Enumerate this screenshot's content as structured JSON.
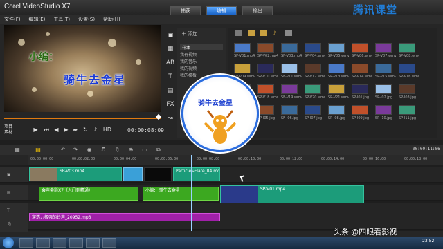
{
  "app": {
    "title": "Corel VideoStudio X7"
  },
  "workspace_tabs": [
    {
      "label": "捕获"
    },
    {
      "label": "编辑"
    },
    {
      "label": "输出"
    }
  ],
  "brand": "腾讯课堂",
  "menu": [
    "文件(F)",
    "编辑(E)",
    "工具(T)",
    "设置(S)",
    "帮助(H)"
  ],
  "preview": {
    "title_line1": "小编：",
    "title_line2": "骑牛去金星",
    "project_label": "项目",
    "clip_label": "素材",
    "hd_label": "HD",
    "timecode": "00:00:08:09",
    "progress": 1.0
  },
  "library": {
    "add_label": "添加",
    "nav_items": [
      "样本",
      "我有视频",
      "我的音乐",
      "我的视频",
      "我的模板"
    ],
    "selected_nav": "样本",
    "thumbs": [
      [
        "SP-V01.mp4",
        "SP-V02.mp4",
        "SP-V03.mp4",
        "SP-V04.wmv",
        "SP-V05.wmv",
        "SP-V06.wmv",
        "SP-V07.wmv",
        "SP-V08.wmv"
      ],
      [
        "SP-V09.wmv",
        "SP-V10.wmv",
        "SP-V11.wmv",
        "SP-V12.wmv",
        "SP-V13.wmv",
        "SP-V14.wmv",
        "SP-V15.wmv",
        "SP-V16.wmv"
      ],
      [
        "SP-V17.wmv",
        "SP-V18.wmv",
        "SP-V19.wmv",
        "SP-V20.wmv",
        "SP-V21.wmv",
        "SP-I01.jpg",
        "SP-I02.jpg",
        "SP-I03.jpg"
      ],
      [
        "SP-I04.jpg",
        "SP-I05.jpg",
        "SP-I06.jpg",
        "SP-I07.jpg",
        "SP-I08.jpg",
        "SP-I09.jpg",
        "SP-I10.jpg",
        "SP-I11.jpg"
      ]
    ],
    "thumb_colors": [
      "#4a7ac8",
      "#8a4a2a",
      "#3a6a9a",
      "#2a4a8a",
      "#6aa0d0",
      "#c0502a",
      "#7a3a9a",
      "#3a9a7a",
      "#c8a03a",
      "#2a2a5a",
      "#9ac0e8",
      "#5a3a2a"
    ]
  },
  "timeline": {
    "timecode": "00:00:11:06",
    "ruler": [
      "00:00:00:00",
      "00:00:02:00",
      "00:00:04:00",
      "00:00:06:00",
      "00:00:08:00",
      "00:00:10:00",
      "00:00:12:00",
      "00:00:14:00",
      "00:00:16:00",
      "00:00:18:00"
    ],
    "video_clips": [
      {
        "label": "SP-V03.mp4"
      },
      {
        "label": "Particle&Flare_04.mov"
      },
      {
        "label": "SP-V01.mp4"
      }
    ],
    "title_clips": [
      {
        "label": "会声会影X7（入门到精通）"
      },
      {
        "label": "小编：  骑牛去金星"
      }
    ],
    "audio_clip": {
      "label": "穿透力极强的铃声_20952.mp3"
    }
  },
  "overlay": {
    "badge_text": "骑牛去金星",
    "watermark": "头条 @四眼看影视"
  },
  "taskbar": {
    "time": "23:52"
  }
}
